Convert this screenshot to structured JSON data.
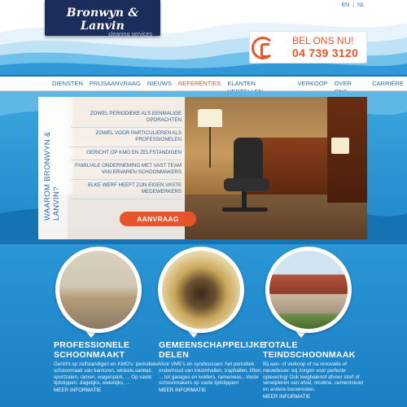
{
  "brand": {
    "name": "Bronwyn & Lanvin",
    "tagline": "cleaning services"
  },
  "languages": [
    "EN",
    "NL"
  ],
  "call": {
    "title": "BEL ONS NU!",
    "number": "04 739 3120",
    "icon": "phone-icon"
  },
  "nav": {
    "items": [
      {
        "label": "DIENSTEN",
        "active": false
      },
      {
        "label": "PRIJSAANVRAAG",
        "active": false
      },
      {
        "label": "NIEUWS",
        "active": false
      },
      {
        "label": "REFERENTIES",
        "active": true
      },
      {
        "label": "KLANTEN VERTELLEN",
        "active": false
      },
      {
        "label": "VERKOOP",
        "active": false
      },
      {
        "label": "OVER ONS",
        "active": false
      },
      {
        "label": "CARRIÈRE",
        "active": false
      }
    ]
  },
  "hero": {
    "side_title": "WAAROM BRONWYN & LANVIN?",
    "bullets": [
      "ZOWEL PERIODIEKE ALS EENMALIGE OPDRACHTEN",
      "ZOWEL VOOR PARTICULIEREN ALS PROFESSIONELEN",
      "GERICHT OP KMO EN ZELFSTANDIGEN",
      "FAMILIALE ONDERNEMING MET VAST TEAM VAN ERVAREN SCHOONMAKERS",
      "ELKE WERF HEEFT ZIJN EIGEN VASTE MEDEWERKERS"
    ],
    "button": "AANVRAAG"
  },
  "services": [
    {
      "title": "PROFESSIONELE SCHOONMAAKT",
      "text": "Gericht op zelfstandigen en KMO's: periodieke schoonmaak van kantoren, winkels,sanitair, sportzalen, ramen, wagenpark, ... Op vaste tijdstippen: dagelijks, wekelijks, ...",
      "more": "MEER INFORMATIE"
    },
    {
      "title": "GEMEENSCHAPPELIJKE DELEN",
      "text": "Voor VME's en syndicussen: het periodiek onderhoud van inkomhallen, traphallen, liften, ... tot garages en kelders, ramenwas...Vaste schoonmakers op vaste tijdstippen!",
      "more": "MEER INFORMATIE"
    },
    {
      "title": "TOTALE TEINDSCHOONMAAK",
      "text": "Bij aan- of verkoop of na renovatie of nieuwbouw: wij zorgen voor perfecte oplevering! Ook leeghalenof afvoer storf of verwijderen van afval, nicotine, cementsluier en andere bouwresten.",
      "more": "MEER INFORMATIE"
    }
  ],
  "colors": {
    "accent": "#e8542a",
    "brand_navy": "#1b2d5a",
    "blue": "#1e86c8",
    "nav_text": "#2a6aa8"
  }
}
